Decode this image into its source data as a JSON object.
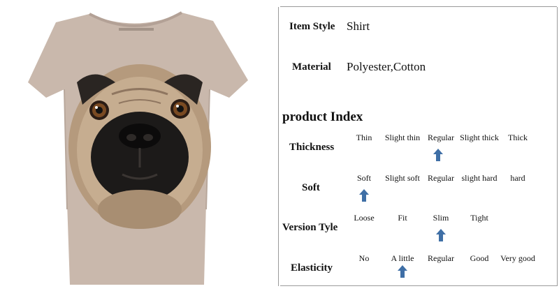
{
  "specs": [
    {
      "label": "Item Style",
      "value": "Shirt"
    },
    {
      "label": "Material",
      "value": "Polyester,Cotton"
    }
  ],
  "index_title": "product Index",
  "rows": [
    {
      "label": "Thickness",
      "options": [
        "Thin",
        "Slight thin",
        "Regular",
        "Slight thick",
        "Thick"
      ],
      "selected": "Regular"
    },
    {
      "label": "Soft",
      "options": [
        "Soft",
        "Slight soft",
        "Regular",
        "slight hard",
        "hard"
      ],
      "selected": "Soft"
    },
    {
      "label": "Version Tyle",
      "options": [
        "Loose",
        "Fit",
        "Slim",
        "Tight"
      ],
      "selected": "Slim"
    },
    {
      "label": "Elasticity",
      "options": [
        "No",
        "A little",
        "Regular",
        "Good",
        "Very good"
      ],
      "selected": "A little"
    }
  ],
  "colors": {
    "shirt": "#c9b8ac",
    "arrow": "#3f6fa6",
    "pug_dark": "#1c1a19",
    "pug_fawn": "#b59a7d"
  }
}
